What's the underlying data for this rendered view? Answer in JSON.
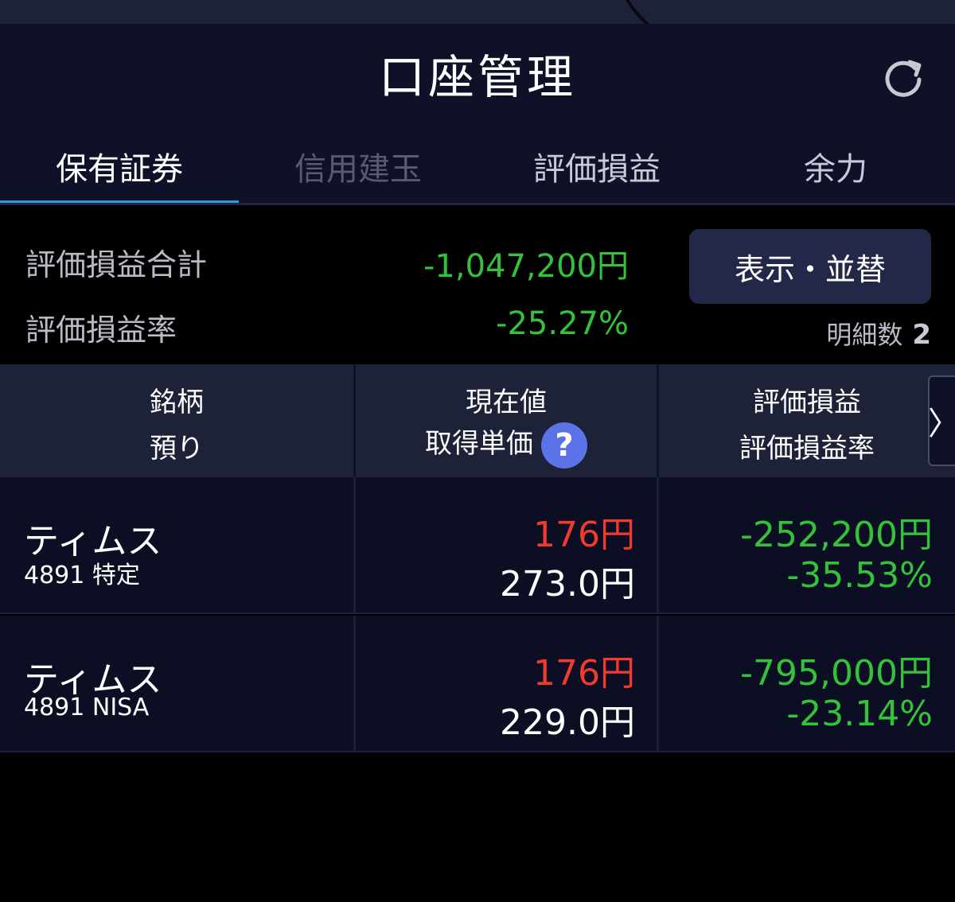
{
  "header": {
    "title": "口座管理"
  },
  "tabs": [
    {
      "label": "保有証券",
      "active": true
    },
    {
      "label": "信用建玉",
      "disabled": true
    },
    {
      "label": "評価損益"
    },
    {
      "label": "余力"
    }
  ],
  "summary": {
    "total_label": "評価損益合計",
    "total_value": "-1,047,200円",
    "rate_label": "評価損益率",
    "rate_value": "-25.27%",
    "display_sort_label": "表示・並替",
    "detail_count_label": "明細数",
    "detail_count_value": "2"
  },
  "table": {
    "col1_line1": "銘柄",
    "col1_line2": "預り",
    "col2_line1": "現在値",
    "col2_line2": "取得単価",
    "col3_line1": "評価損益",
    "col3_line2": "評価損益率",
    "scroll_glyph": "〉",
    "help_glyph": "?",
    "rows": [
      {
        "name": "ティムス",
        "sub": "4891 特定",
        "current": "176円",
        "cost": "273.0円",
        "pl": "-252,200円",
        "rate": "-35.53%"
      },
      {
        "name": "ティムス",
        "sub": "4891 NISA",
        "current": "176円",
        "cost": "229.0円",
        "pl": "-795,000円",
        "rate": "-23.14%"
      }
    ]
  },
  "colors": {
    "background": "#000000",
    "header_bg": "#0e1128",
    "tab_accent": "#2e9bdc",
    "gain_negative": "#33c23a",
    "price_up": "#f23a2e",
    "button_bg": "#242848"
  }
}
